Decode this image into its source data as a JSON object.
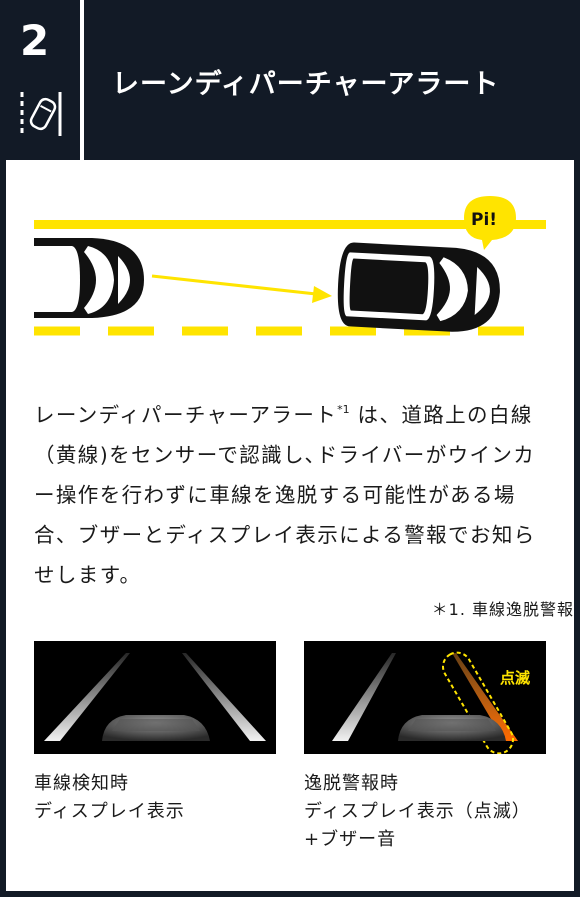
{
  "header": {
    "number": "2",
    "title": "レーンディパーチャーアラート",
    "icon": "lane-departure-icon"
  },
  "illustration": {
    "sound_label": "Pi!",
    "line_color": "#ffe400",
    "car_color": "#111111"
  },
  "description": {
    "lead": "レーンディパーチャーアラート",
    "note_mark": "*1",
    "rest": " は、道路上の白線（黄線)をセンサーで認識し､ドライバーがウインカー操作を行わずに車線を逸脱する可能性がある場合、ブザーとディスプレイ表示による警報でお知らせします。"
  },
  "footnote": "＊1. 車線逸脱警報",
  "screens": [
    {
      "caption_line1": "車線検知時",
      "caption_line2": "ディスプレイ表示"
    },
    {
      "flash_label": "点滅",
      "caption_line1": "逸脱警報時",
      "caption_line2": "ディスプレイ表示（点滅）",
      "caption_line3": "+ブザー音"
    }
  ],
  "colors": {
    "header_bg": "#121a26",
    "accent_yellow": "#ffe400",
    "warning_orange": "#ff6a00"
  }
}
